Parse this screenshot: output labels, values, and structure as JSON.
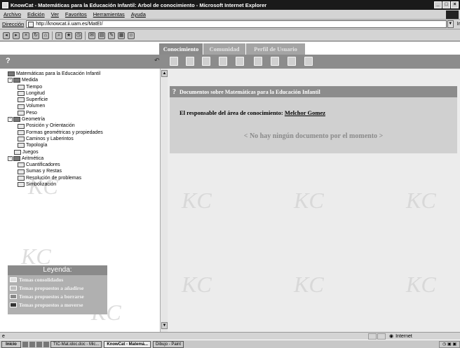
{
  "window": {
    "title": "KnowCat - Matemáticas para la Educación Infantil: Arbol de conocimiento - Microsoft Internet Explorer"
  },
  "menu": {
    "items": [
      "Archivo",
      "Edición",
      "Ver",
      "Favoritos",
      "Herramientas",
      "Ayuda"
    ]
  },
  "address": {
    "label": "Dirección",
    "url": "http://knowcat.ii.uam.es/MatEI/",
    "go": "Ir"
  },
  "tabs": [
    "Conocimiento",
    "Comunidad",
    "Perfil de Usuario"
  ],
  "appbar": {
    "help": "?",
    "nav": "↶"
  },
  "tree": [
    {
      "label": "Matemáticas para la Educación Infantil",
      "level": 0,
      "expander": "",
      "state": "root"
    },
    {
      "label": "Medida",
      "level": 1,
      "expander": "−",
      "state": "open"
    },
    {
      "label": "Tiempo",
      "level": 2,
      "expander": "",
      "state": "leaf"
    },
    {
      "label": "Longitud",
      "level": 2,
      "expander": "",
      "state": "leaf"
    },
    {
      "label": "Superficie",
      "level": 2,
      "expander": "",
      "state": "leaf"
    },
    {
      "label": "Volumen",
      "level": 2,
      "expander": "",
      "state": "leaf"
    },
    {
      "label": "Peso",
      "level": 2,
      "expander": "",
      "state": "leaf"
    },
    {
      "label": "Geometría",
      "level": 1,
      "expander": "−",
      "state": "open"
    },
    {
      "label": "Posición y Orientación",
      "level": 2,
      "expander": "",
      "state": "leaf"
    },
    {
      "label": "Formas geométricas y propiedades",
      "level": 2,
      "expander": "",
      "state": "leaf"
    },
    {
      "label": "Caminos y Laberintos",
      "level": 2,
      "expander": "",
      "state": "leaf"
    },
    {
      "label": "Topología",
      "level": 2,
      "expander": "",
      "state": "leaf"
    },
    {
      "label": "Juegos",
      "level": 1,
      "expander": "",
      "state": "leaf"
    },
    {
      "label": "Aritmética",
      "level": 1,
      "expander": "−",
      "state": "open"
    },
    {
      "label": "Cuantificadores",
      "level": 2,
      "expander": "",
      "state": "leaf"
    },
    {
      "label": "Sumas y Restas",
      "level": 2,
      "expander": "",
      "state": "leaf"
    },
    {
      "label": "Resolución de problemas",
      "level": 2,
      "expander": "",
      "state": "leaf"
    },
    {
      "label": "Simbolización",
      "level": 2,
      "expander": "",
      "state": "leaf"
    }
  ],
  "legend": {
    "title": "Leyenda:",
    "items": [
      "Temas consolidados",
      "Temas propuestos a añadirse",
      "Temas propuestos a borrarse",
      "Temas propuestos a moverse"
    ]
  },
  "main": {
    "header_icon": "?",
    "header": "Documentos sobre Matemáticas para la Educación Infantil",
    "responsible_label": "El responsable del área de conocimiento:",
    "responsible_name": "Melchor Gomez",
    "no_docs": "< No hay ningún documento por el momento >"
  },
  "watermark": "KC",
  "statusbar": {
    "zone": "Internet"
  },
  "taskbar": {
    "start": "Inicio",
    "tasks": [
      "TIC-Mat.idoc.doc - Mic...",
      "KnowCat - Matemá...",
      "Dibujo - Paint"
    ]
  }
}
